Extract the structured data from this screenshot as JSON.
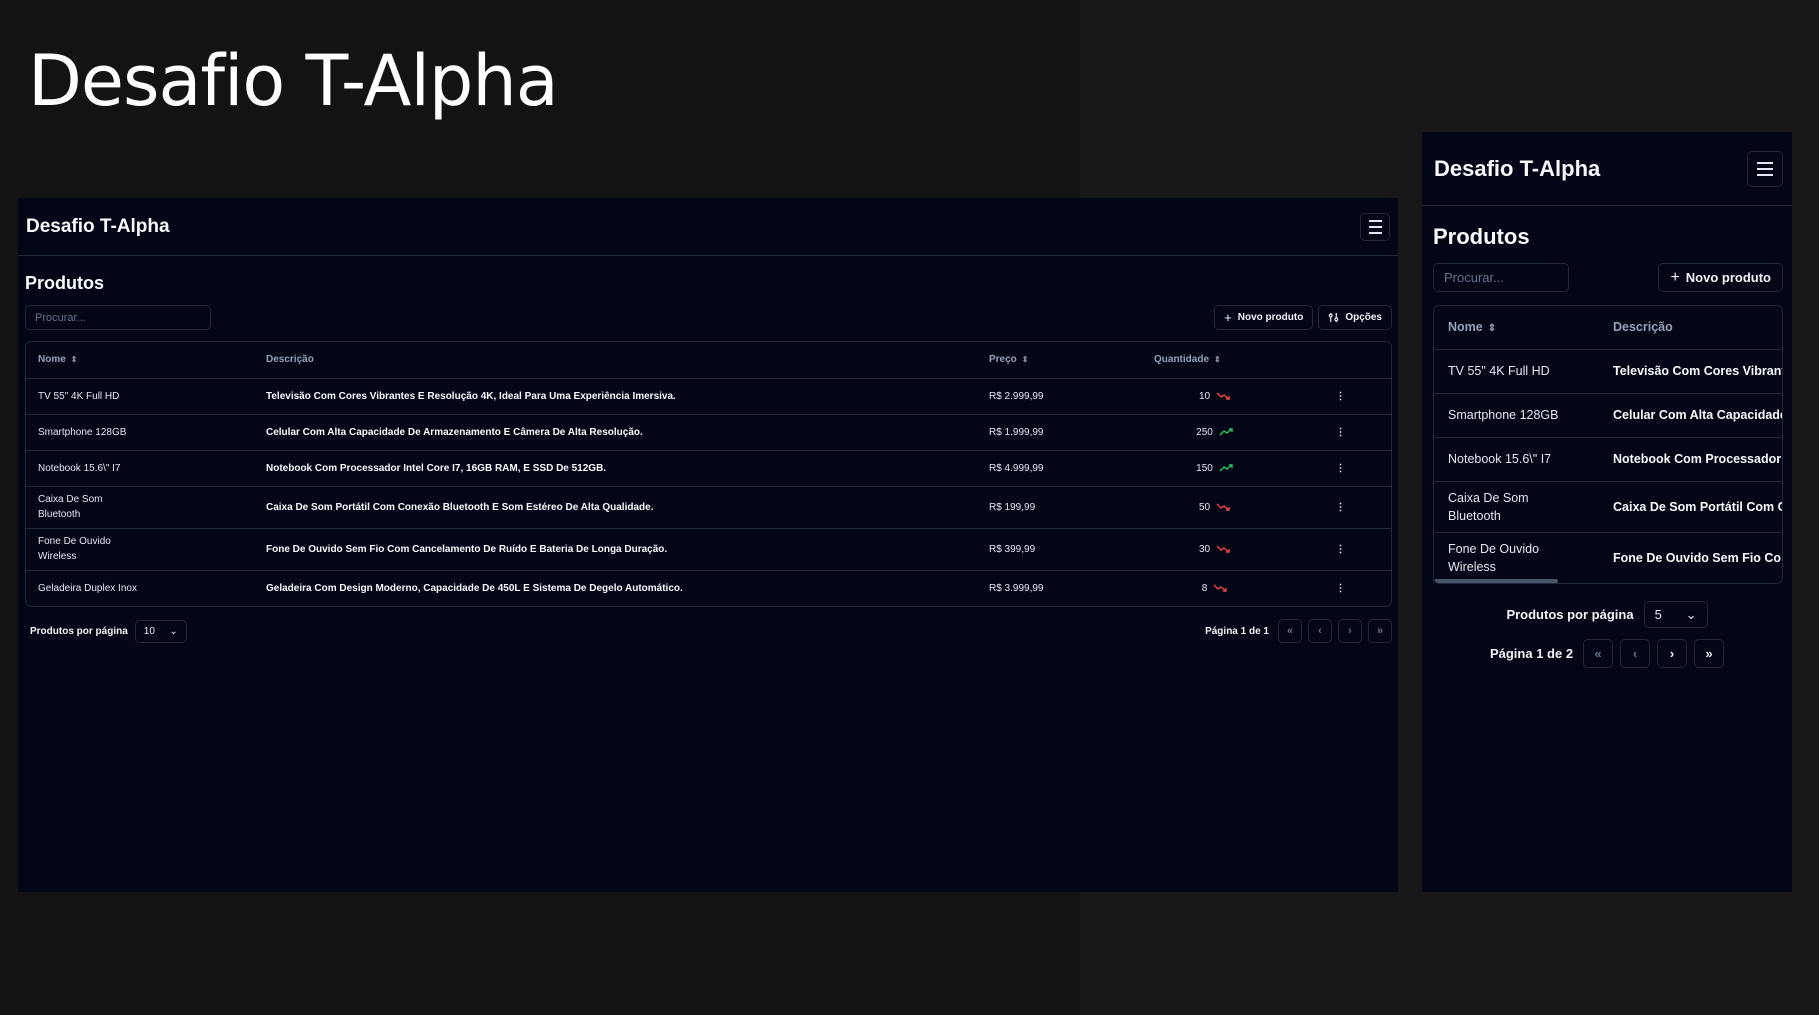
{
  "hero": {
    "title": "Desafio T-Alpha"
  },
  "app": {
    "brand": "Desafio T-Alpha",
    "section_title": "Produtos",
    "search_placeholder": "Procurar...",
    "new_product_label": "Novo produto",
    "options_label": "Opções",
    "columns": {
      "name": "Nome",
      "description": "Descrição",
      "price": "Preço",
      "quantity": "Quantidade"
    },
    "products": [
      {
        "name": "TV 55\" 4K Full HD",
        "description": "Televisão Com Cores Vibrantes E Resolução 4K, Ideal Para Uma Experiência Imersiva.",
        "price": "R$ 2.999,99",
        "quantity": "10",
        "trend": "down"
      },
      {
        "name": "Smartphone 128GB",
        "description": "Celular Com Alta Capacidade De Armazenamento E Câmera De Alta Resolução.",
        "price": "R$ 1.999,99",
        "quantity": "250",
        "trend": "up"
      },
      {
        "name": "Notebook 15.6\\\" I7",
        "description": "Notebook Com Processador Intel Core I7, 16GB RAM, E SSD De 512GB.",
        "price": "R$ 4.999,99",
        "quantity": "150",
        "trend": "up"
      },
      {
        "name": "Caixa De Som Bluetooth",
        "description": "Caixa De Som Portátil Com Conexão Bluetooth E Som Estéreo De Alta Qualidade.",
        "price": "R$ 199,99",
        "quantity": "50",
        "trend": "down"
      },
      {
        "name": "Fone De Ouvido Wireless",
        "description": "Fone De Ouvido Sem Fio Com Cancelamento De Ruído E Bateria De Longa Duração.",
        "price": "R$ 399,99",
        "quantity": "30",
        "trend": "down"
      },
      {
        "name": "Geladeira Duplex Inox",
        "description": "Geladeira Com Design Moderno, Capacidade De 450L E Sistema De Degelo Automático.",
        "price": "R$ 3.999,99",
        "quantity": "8",
        "trend": "down"
      }
    ],
    "per_page_label": "Produtos por página",
    "desktop_pagination": {
      "per_page_value": "10",
      "page_text": "Página 1 de 1"
    },
    "mobile_pagination": {
      "per_page_value": "5",
      "page_text": "Página 1 de 2"
    },
    "colors": {
      "trend_up": "#22c55e",
      "trend_down": "#ef4444",
      "panel_bg": "#020617",
      "border": "#1e293b"
    }
  }
}
